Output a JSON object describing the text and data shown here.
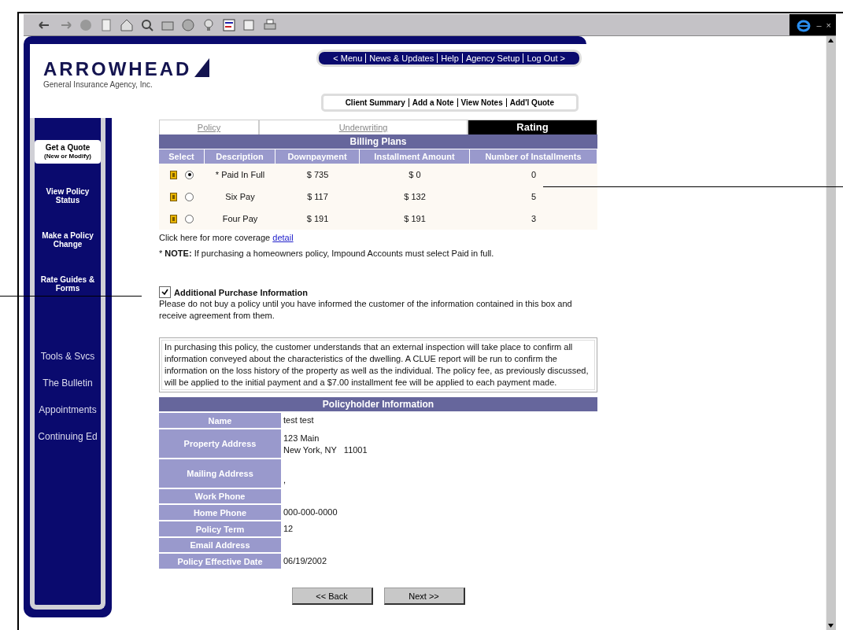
{
  "window_controls": [
    "–",
    "×"
  ],
  "logo": {
    "name": "ARROWHEAD",
    "tagline": "General Insurance Agency, Inc."
  },
  "menu_links": [
    "< Menu",
    "News & Updates",
    "Help",
    "Agency Setup",
    "Log Out >"
  ],
  "client_links": [
    "Client Summary",
    "Add a Note",
    "View Notes",
    "Add'l Quote"
  ],
  "sidebar": {
    "buttons": [
      {
        "label": "Get a Quote",
        "sublabel": "(New or Modify)",
        "selected": true
      },
      {
        "label": "View Policy Status",
        "selected": false
      },
      {
        "label": "Make a Policy Change",
        "selected": false
      },
      {
        "label": "Rate Guides & Forms",
        "selected": false
      }
    ],
    "links": [
      "Tools & Svcs",
      "The Bulletin",
      "Appointments",
      "Continuing Ed"
    ]
  },
  "tabs": [
    {
      "label": "Policy",
      "selected": false
    },
    {
      "label": "Underwriting",
      "selected": false
    },
    {
      "label": "Rating",
      "selected": true
    }
  ],
  "billing_plans": {
    "title": "Billing Plans",
    "columns": [
      "Select",
      "Description",
      "Downpayment",
      "Installment Amount",
      "Number of Installments"
    ],
    "rows": [
      {
        "selected": true,
        "description": "* Paid In Full",
        "downpayment": "$ 735",
        "installment": "$ 0",
        "count": "0"
      },
      {
        "selected": false,
        "description": "Six Pay",
        "downpayment": "$ 117",
        "installment": "$ 132",
        "count": "5"
      },
      {
        "selected": false,
        "description": "Four Pay",
        "downpayment": "$ 191",
        "installment": "$ 191",
        "count": "3"
      }
    ]
  },
  "coverage": {
    "text": "Click here for more coverage",
    "link": "detail"
  },
  "note": "* **NOTE:** If purchasing a homeowners policy, Impound Accounts must select Paid in full.",
  "additional": {
    "checked": true,
    "title": "Additional Purchase Information",
    "text": "Please do not buy a policy until you have informed the customer of the information contained in this box and receive agreement from them.",
    "box": "In purchasing this policy, the customer understands that an external inspection will take place to confirm all information conveyed about the characteristics of the dwelling. A CLUE report will be run to confirm the information on the loss history of the property as well as the individual. The policy fee, as previously discussed, will be applied to the initial payment and a $7.00 installment fee will be applied to each payment made."
  },
  "policyholder": {
    "title": "Policyholder Information",
    "rows": [
      {
        "label": "Name",
        "lines": [
          "test test"
        ]
      },
      {
        "label": "Property Address",
        "lines": [
          "123 Main",
          "New York, NY   11001"
        ]
      },
      {
        "label": "Mailing Address",
        "lines": [
          ","
        ]
      },
      {
        "label": "Work Phone"
      },
      {
        "label": "Home Phone",
        "lines": [
          "000-000-0000"
        ]
      },
      {
        "label": "Policy Term",
        "lines": [
          "12"
        ]
      },
      {
        "label": "Email Address"
      },
      {
        "label": "Policy Effective Date",
        "lines": [
          "06/19/2002"
        ]
      }
    ]
  },
  "buttons": [
    "<< Back",
    "Next >>"
  ]
}
